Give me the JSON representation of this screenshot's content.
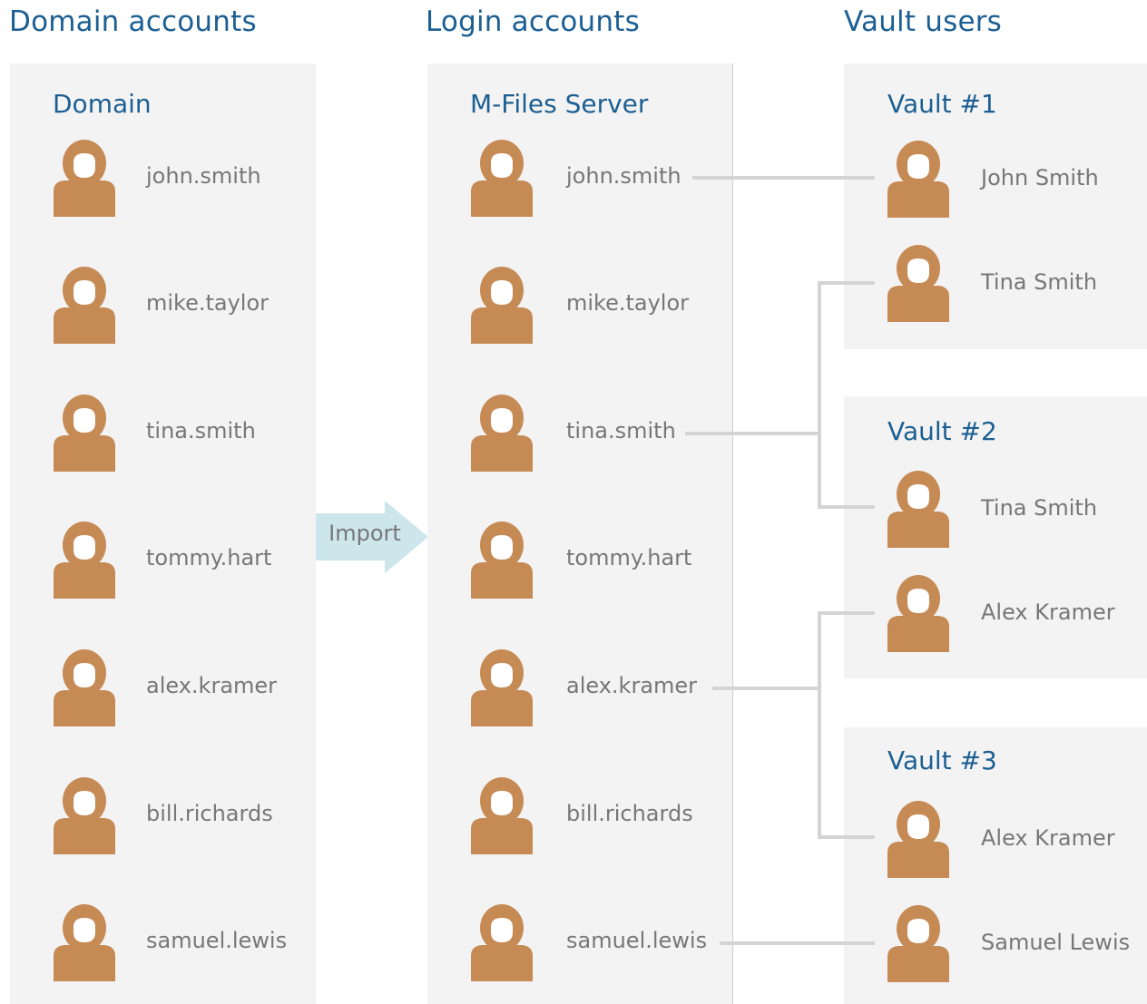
{
  "headings": {
    "domain_accounts": "Domain accounts",
    "login_accounts": "Login accounts",
    "vault_users": "Vault users"
  },
  "domain_panel": {
    "title": "Domain",
    "users": [
      "john.smith",
      "mike.taylor",
      "tina.smith",
      "tommy.hart",
      "alex.kramer",
      "bill.richards",
      "samuel.lewis"
    ]
  },
  "server_panel": {
    "title": "M-Files Server",
    "users": [
      "john.smith",
      "mike.taylor",
      "tina.smith",
      "tommy.hart",
      "alex.kramer",
      "bill.richards",
      "samuel.lewis"
    ]
  },
  "import_label": "Import",
  "vaults": [
    {
      "title": "Vault #1",
      "users": [
        "John Smith",
        "Tina Smith"
      ]
    },
    {
      "title": "Vault #2",
      "users": [
        "Tina Smith",
        "Alex Kramer"
      ]
    },
    {
      "title": "Vault #3",
      "users": [
        "Alex Kramer",
        "Samuel Lewis"
      ]
    }
  ],
  "colors": {
    "heading": "#1c5f92",
    "panel_bg": "#f3f3f3",
    "user_icon": "#c68a55",
    "label": "#777777",
    "connector": "#d4d4d4",
    "import_arrow": "#cde6ec"
  },
  "icons": {
    "user": "user-icon",
    "arrow": "arrow-right-icon"
  }
}
